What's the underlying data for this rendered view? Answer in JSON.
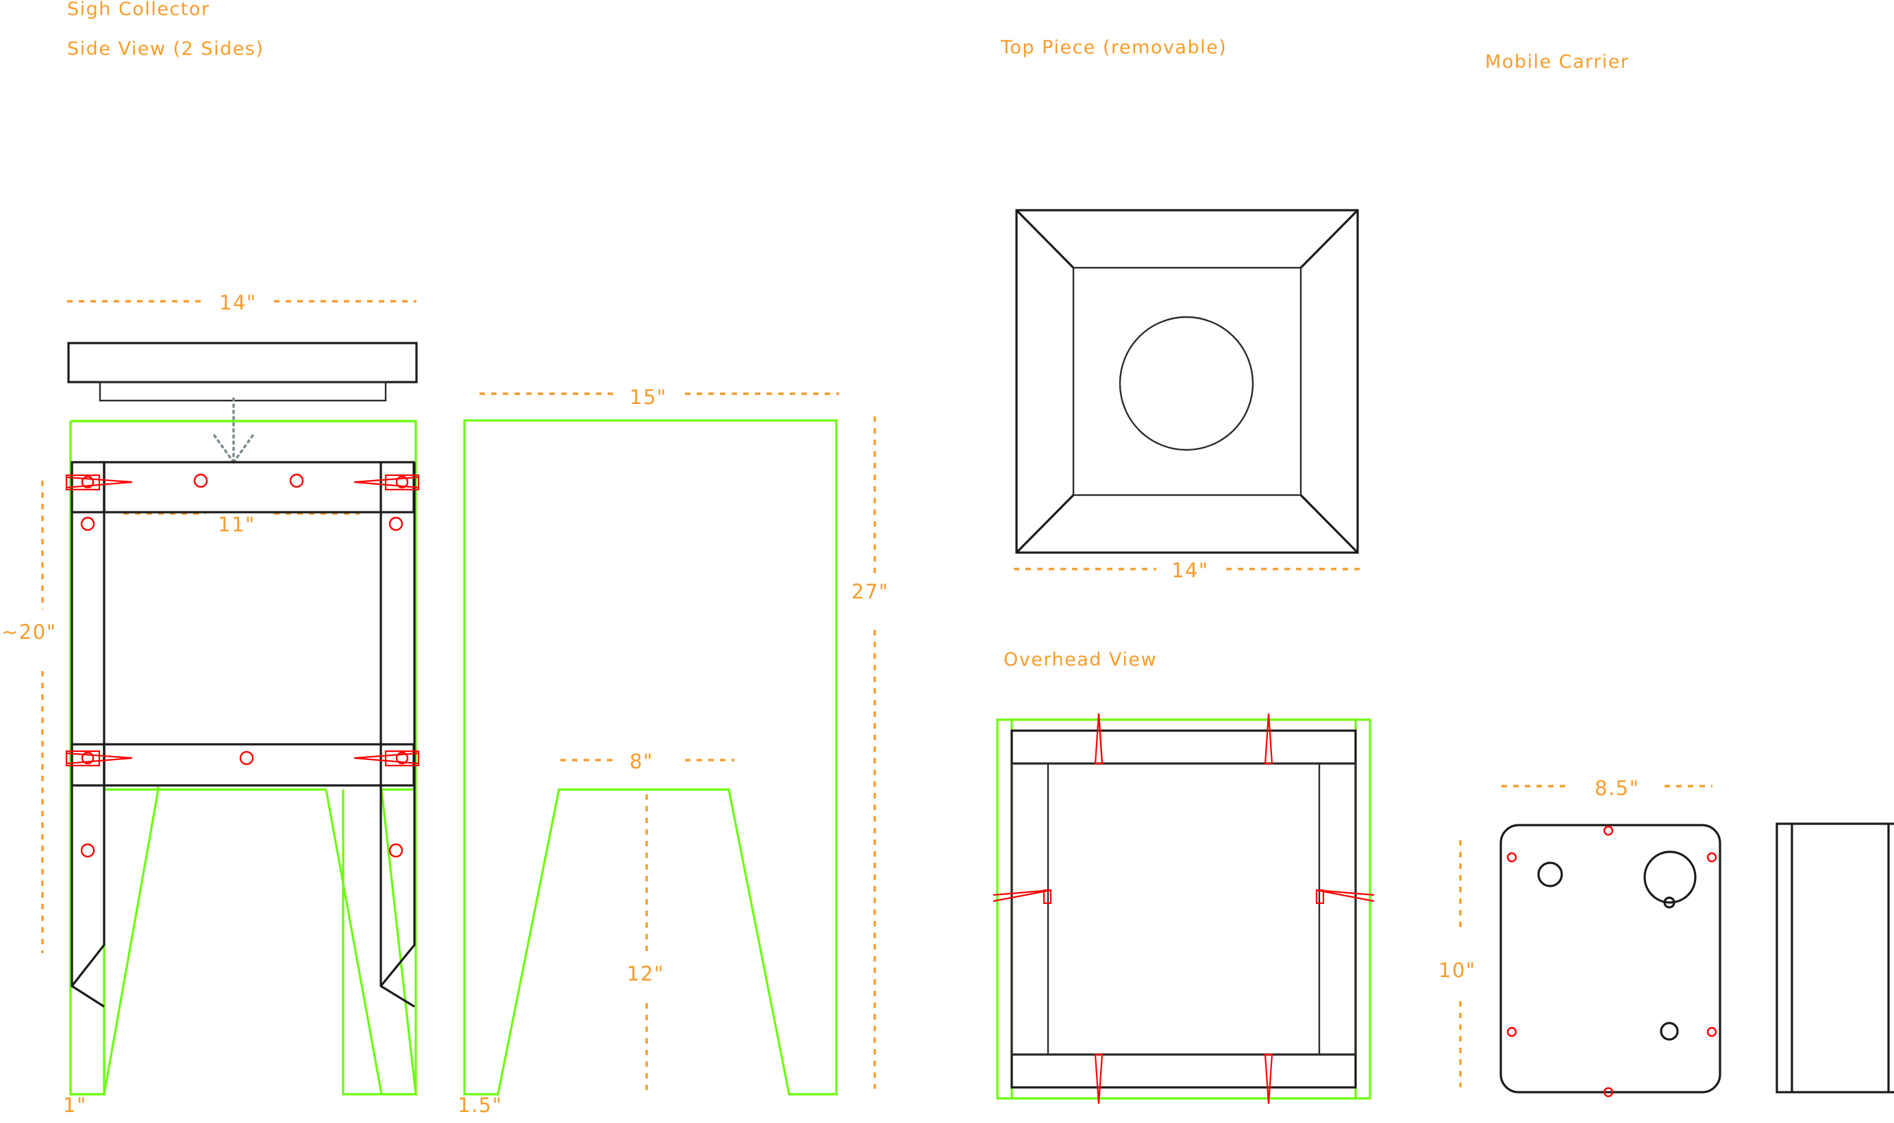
{
  "document": {
    "title": "Sigh Collector",
    "background_color": "#ffffff",
    "accent_color": "#f79c2b",
    "outline_color": "#1a1a1a",
    "profile_color": "#6dfa10",
    "hardware_color": "#fe0000"
  },
  "sections": {
    "side_view": {
      "title": "Sigh Collector",
      "subtitle": "Side View (2 Sides)",
      "dimensions": {
        "top_width": "14\"",
        "inner_width": "11\"",
        "left_height": "~20\"",
        "foot_width": "1\""
      }
    },
    "profile_view": {
      "dimensions": {
        "width": "15\"",
        "height": "27\"",
        "notch_width": "8\"",
        "leg_height": "12\"",
        "foot_width": "1.5\""
      }
    },
    "top_piece": {
      "title": "Top Piece (removable)",
      "dimensions": {
        "width": "14\""
      }
    },
    "overhead": {
      "title": "Overhead View"
    },
    "mobile_carrier": {
      "title": "Mobile Carrier",
      "dimensions": {
        "width": "8.5\"",
        "height": "10\""
      }
    }
  }
}
